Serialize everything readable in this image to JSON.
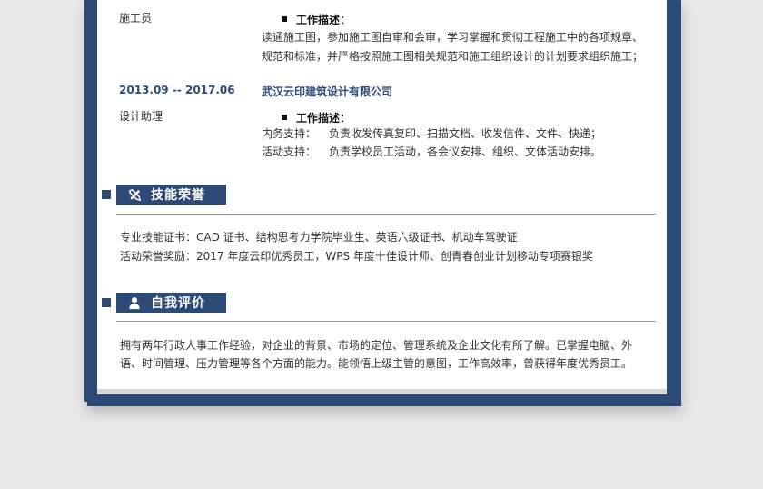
{
  "experience": [
    {
      "role": "施工员",
      "desc_title": "工作描述：",
      "lines": [
        "读通施工图，参加施工图自审和会审，学习掌握和贯彻工程施工中的各项规章、",
        "规范和标准，并严格按照施工图相关规范和施工组织设计的计划要求组织施工；"
      ]
    },
    {
      "date": "2013.09 -- 2017.06",
      "company": "武汉云印建筑设计有限公司",
      "role": "设计助理",
      "desc_title": "工作描述：",
      "rows": [
        {
          "label": "内务支持：",
          "text": "负责收发传真复印、扫描文档、收发信件、文件、快递；"
        },
        {
          "label": "活动支持：",
          "text": "负责学校员工活动，各会议安排、组织、文体活动安排。"
        }
      ]
    }
  ],
  "skills": {
    "title": "技能荣誉",
    "icon": "tools-icon",
    "lines": [
      "专业技能证书：CAD 证书、结构思考力学院毕业生、英语六级证书、机动车驾驶证",
      "活动荣誉奖励：2017 年度云印优秀员工，WPS 年度十佳设计师、创青春创业计划移动专项赛银奖"
    ]
  },
  "self_eval": {
    "title": "自我评价",
    "icon": "person-icon",
    "lines": [
      "拥有两年行政人事工作经验，对企业的背景、市场的定位、管理系统及企业文化有所了解。已掌握电脑、外",
      "语、时间管理、压力管理等各个方面的能力。能领悟上级主管的意图，工作高效率，曾获得年度优秀员工。"
    ]
  },
  "colors": {
    "accent": "#2d4a77",
    "background": "#e8e8e8"
  }
}
